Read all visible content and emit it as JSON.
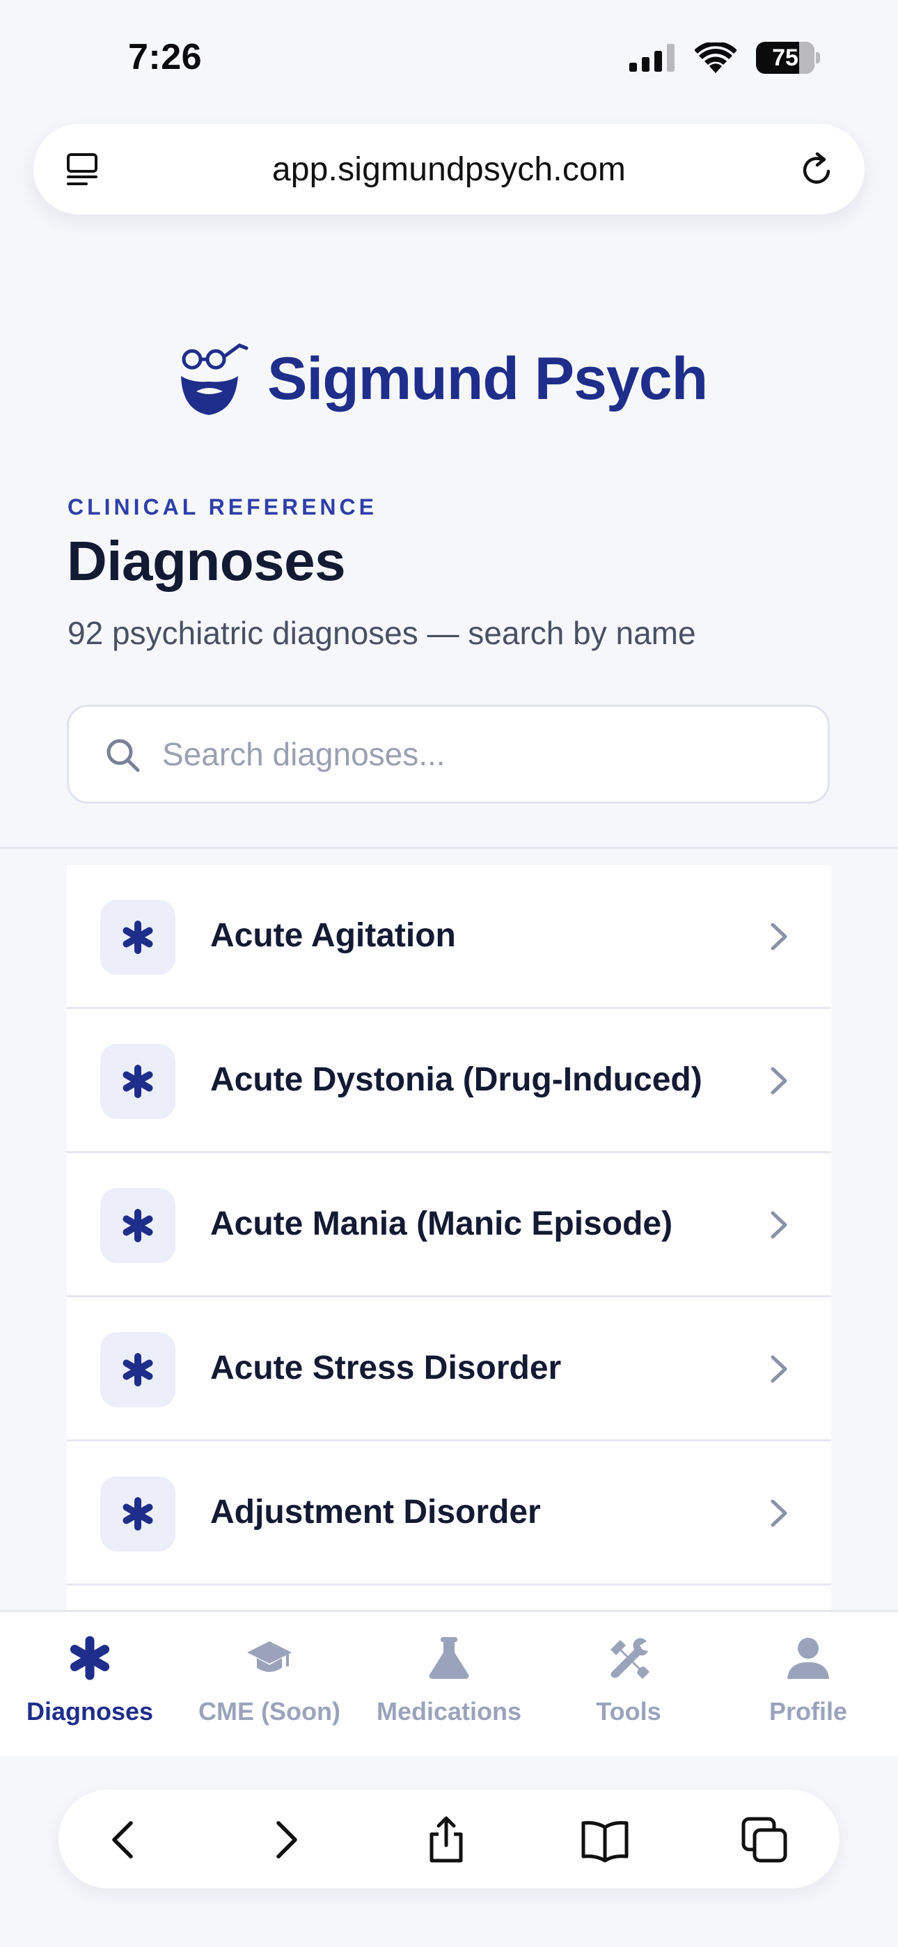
{
  "status_bar": {
    "time": "7:26",
    "battery_level": "75"
  },
  "browser": {
    "url": "app.sigmundpsych.com",
    "toolbar_buttons": [
      "back",
      "forward",
      "share",
      "bookmarks",
      "tabs"
    ]
  },
  "brand": {
    "name": "Sigmund Psych",
    "color": "#1f2e8a"
  },
  "header": {
    "eyebrow": "CLINICAL REFERENCE",
    "title": "Diagnoses",
    "subtitle": "92 psychiatric diagnoses — search by name"
  },
  "search": {
    "placeholder": "Search diagnoses...",
    "value": ""
  },
  "diagnoses": [
    {
      "label": "Acute Agitation",
      "icon": "asterisk-icon"
    },
    {
      "label": "Acute Dystonia (Drug-Induced)",
      "icon": "asterisk-icon"
    },
    {
      "label": "Acute Mania (Manic Episode)",
      "icon": "asterisk-icon"
    },
    {
      "label": "Acute Stress Disorder",
      "icon": "asterisk-icon"
    },
    {
      "label": "Adjustment Disorder",
      "icon": "asterisk-icon"
    }
  ],
  "tabs": [
    {
      "label": "Diagnoses",
      "icon": "asterisk-icon",
      "active": true
    },
    {
      "label": "CME (Soon)",
      "icon": "graduation-cap-icon",
      "active": false
    },
    {
      "label": "Medications",
      "icon": "flask-icon",
      "active": false
    },
    {
      "label": "Tools",
      "icon": "tools-icon",
      "active": false
    },
    {
      "label": "Profile",
      "icon": "person-icon",
      "active": false
    }
  ],
  "colors": {
    "accent": "#1f2e8a",
    "inactive": "#9aa3ba",
    "background": "#f6f7fb"
  }
}
